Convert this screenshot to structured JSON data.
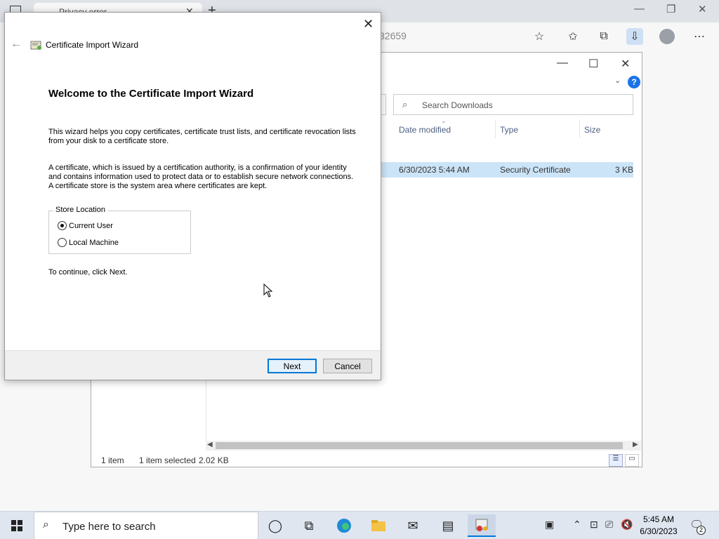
{
  "browser": {
    "tab_title": "Privacy error",
    "address_fragment": "32659"
  },
  "explorer": {
    "search_placeholder": "Search Downloads",
    "columns": [
      "Date modified",
      "Type",
      "Size"
    ],
    "file": {
      "date_modified": "6/30/2023 5:44 AM",
      "type": "Security Certificate",
      "size": "3 KB"
    },
    "status": {
      "item_count": "1 item",
      "selected": "1 item selected",
      "selected_size": "2.02 KB"
    }
  },
  "wizard": {
    "title": "Certificate Import Wizard",
    "heading": "Welcome to the Certificate Import Wizard",
    "para1": "This wizard helps you copy certificates, certificate trust lists, and certificate revocation lists from your disk to a certificate store.",
    "para2": "A certificate, which is issued by a certification authority, is a confirmation of your identity and contains information used to protect data or to establish secure network connections. A certificate store is the system area where certificates are kept.",
    "store_location_label": "Store Location",
    "options": [
      "Current User",
      "Local Machine"
    ],
    "selected_option": "Current User",
    "continue_text": "To continue, click Next.",
    "next_label": "Next",
    "cancel_label": "Cancel"
  },
  "taskbar": {
    "search_placeholder": "Type here to search",
    "time": "5:45 AM",
    "date": "6/30/2023",
    "notification_count": "2"
  },
  "colors": {
    "accent": "#0078d7",
    "selection": "#cce4f7",
    "taskbar": "#dfe6f0"
  }
}
